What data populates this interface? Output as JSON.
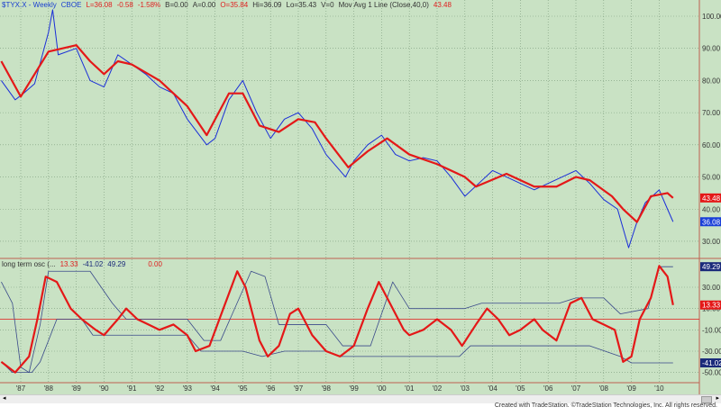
{
  "header": {
    "symbol": "$TYX.X - Weekly",
    "exchange": "CBOE",
    "last": "L=36.08",
    "change": "-0.58",
    "pct": "-1.58%",
    "bid": "B=0.00",
    "ask": "A=0.00",
    "open": "O=35.84",
    "high": "Hi=36.09",
    "low": "Lo=35.43",
    "volume": "V=0",
    "study": "Mov Avg 1 Line (Close,40,0)",
    "study_value": "43.48"
  },
  "osc_header": {
    "name": "long term osc (...",
    "v1": "13.33",
    "v2": "-41.02",
    "v3": "49.29",
    "v4": "0.00"
  },
  "footer": "Created with TradeStation. ©TradeStation Technologies, Inc. All rights reserved.",
  "colors": {
    "bg": "#c9e2c4",
    "price": "#1a2ed8",
    "ma": "#e41818",
    "band": "#3a4a8a"
  },
  "chart_data": [
    {
      "type": "line",
      "title": "$TYX.X - Weekly",
      "ylim": [
        25,
        105
      ],
      "yticks": [
        "100.00",
        "90.00",
        "80.00",
        "70.00",
        "60.00",
        "50.00",
        "40.00",
        "30.00"
      ],
      "xticks": [
        "'87",
        "'88",
        "'89",
        "'90",
        "'91",
        "'92",
        "'93",
        "'94",
        "'95",
        "'96",
        "'97",
        "'98",
        "'99",
        "'00",
        "'01",
        "'02",
        "'03",
        "'04",
        "'05",
        "'06",
        "'07",
        "'08",
        "'09",
        "'10"
      ],
      "series": [
        {
          "name": "$TYX.X",
          "x": [
            1986.3,
            1986.8,
            1987.1,
            1987.5,
            1988.0,
            1988.15,
            1988.35,
            1989.0,
            1989.5,
            1990.0,
            1990.5,
            1991.0,
            1991.5,
            1992.0,
            1992.5,
            1993.0,
            1993.7,
            1994.0,
            1994.5,
            1995.0,
            1995.5,
            1996.0,
            1996.5,
            1997.0,
            1997.5,
            1998.0,
            1998.7,
            1999.0,
            1999.5,
            2000.0,
            2000.5,
            2001.0,
            2001.5,
            2002.0,
            2002.5,
            2003.0,
            2003.5,
            2004.0,
            2004.5,
            2005.0,
            2005.5,
            2006.0,
            2006.5,
            2007.0,
            2007.5,
            2008.0,
            2008.5,
            2008.9,
            2009.2,
            2009.5,
            2010.0,
            2010.3,
            2010.5
          ],
          "y": [
            80,
            74,
            76,
            79,
            95,
            102,
            88,
            90,
            80,
            78,
            88,
            85,
            82,
            78,
            76,
            68,
            60,
            62,
            74,
            80,
            70,
            62,
            68,
            70,
            65,
            57,
            50,
            55,
            60,
            63,
            57,
            55,
            56,
            55,
            50,
            44,
            48,
            52,
            50,
            48,
            46,
            48,
            50,
            52,
            48,
            43,
            40,
            28,
            36,
            42,
            46,
            40,
            36.08
          ]
        },
        {
          "name": "Mov Avg 1 Line (Close,40,0)",
          "x": [
            1986.3,
            1987.0,
            1987.5,
            1988.0,
            1989.0,
            1989.5,
            1990.0,
            1990.5,
            1991.0,
            1992.0,
            1993.0,
            1993.7,
            1994.5,
            1995.0,
            1995.6,
            1996.3,
            1997.0,
            1997.6,
            1998.0,
            1998.8,
            1999.5,
            2000.2,
            2001.0,
            2002.0,
            2003.0,
            2003.4,
            2004.5,
            2005.5,
            2006.3,
            2007.0,
            2007.5,
            2008.3,
            2008.7,
            2009.2,
            2009.7,
            2010.3,
            2010.5
          ],
          "y": [
            86,
            75,
            82,
            89,
            91,
            86,
            82,
            86,
            85,
            80,
            72,
            63,
            76,
            76,
            66,
            64,
            68,
            67,
            62,
            53,
            58,
            62,
            57,
            54,
            50,
            47,
            51,
            47,
            47,
            50,
            49,
            44,
            40,
            36,
            44,
            45,
            43.48
          ]
        }
      ]
    },
    {
      "type": "line",
      "title": "long term osc",
      "ylim": [
        -55,
        55
      ],
      "yticks": [
        "30.00",
        "10.00",
        "-10.00",
        "-30.00",
        "-50.00"
      ],
      "series": [
        {
          "name": "osc",
          "x": [
            1986.3,
            1986.8,
            1987.3,
            1987.6,
            1987.9,
            1988.3,
            1988.8,
            1989.2,
            1989.7,
            1990.0,
            1990.5,
            1990.8,
            1991.2,
            1991.6,
            1992.0,
            1992.5,
            1993.0,
            1993.3,
            1993.8,
            1994.3,
            1994.8,
            1995.1,
            1995.6,
            1995.9,
            1996.3,
            1996.7,
            1997.0,
            1997.5,
            1998.0,
            1998.5,
            1999.0,
            1999.5,
            1999.9,
            2000.3,
            2000.8,
            2001.0,
            2001.5,
            2002.0,
            2002.5,
            2002.9,
            2003.4,
            2003.8,
            2004.2,
            2004.6,
            2005.0,
            2005.5,
            2005.8,
            2006.3,
            2006.8,
            2007.2,
            2007.6,
            2008.0,
            2008.4,
            2008.7,
            2009.0,
            2009.3,
            2009.7,
            2010.0,
            2010.3,
            2010.5
          ],
          "y": [
            -40,
            -50,
            -35,
            0,
            40,
            35,
            10,
            0,
            -10,
            -15,
            0,
            10,
            0,
            -5,
            -10,
            -5,
            -15,
            -30,
            -25,
            10,
            45,
            30,
            -20,
            -35,
            -25,
            5,
            10,
            -15,
            -30,
            -35,
            -25,
            10,
            35,
            15,
            -10,
            -15,
            -10,
            0,
            -10,
            -25,
            -5,
            10,
            0,
            -15,
            -10,
            0,
            -10,
            -20,
            15,
            20,
            0,
            -5,
            -10,
            -40,
            -35,
            0,
            20,
            50,
            40,
            13.33
          ]
        },
        {
          "name": "upper band",
          "x": [
            1986.3,
            1986.7,
            1987.0,
            1987.3,
            1987.7,
            1988.0,
            1989.5,
            1990.3,
            1990.8,
            1993.0,
            1993.6,
            1994.2,
            1995.3,
            1995.8,
            1996.3,
            1998.0,
            1998.6,
            1999.6,
            2000.4,
            2001.0,
            2003.0,
            2003.6,
            2006.4,
            2007.0,
            2008.0,
            2008.6,
            2009.6,
            2010.0,
            2010.5
          ],
          "y": [
            35,
            15,
            -45,
            -50,
            -5,
            45,
            45,
            15,
            0,
            0,
            -20,
            -20,
            45,
            40,
            -5,
            -5,
            -25,
            -25,
            35,
            10,
            10,
            15,
            15,
            20,
            20,
            5,
            10,
            49.29,
            49.29
          ]
        },
        {
          "name": "lower band",
          "x": [
            1986.3,
            1986.7,
            1987.4,
            1987.7,
            1988.3,
            1989.2,
            1989.6,
            1993.0,
            1993.5,
            1995.0,
            1995.7,
            1996.5,
            1998.0,
            1998.5,
            2002.8,
            2003.2,
            2006.0,
            2007.5,
            2008.6,
            2009.0,
            2010.5
          ],
          "y": [
            -40,
            -50,
            -50,
            -40,
            0,
            0,
            -15,
            -15,
            -30,
            -30,
            -35,
            -30,
            -30,
            -35,
            -35,
            -25,
            -25,
            -25,
            -35,
            -41.02,
            -41.02
          ]
        }
      ],
      "reference_line": 0
    }
  ]
}
